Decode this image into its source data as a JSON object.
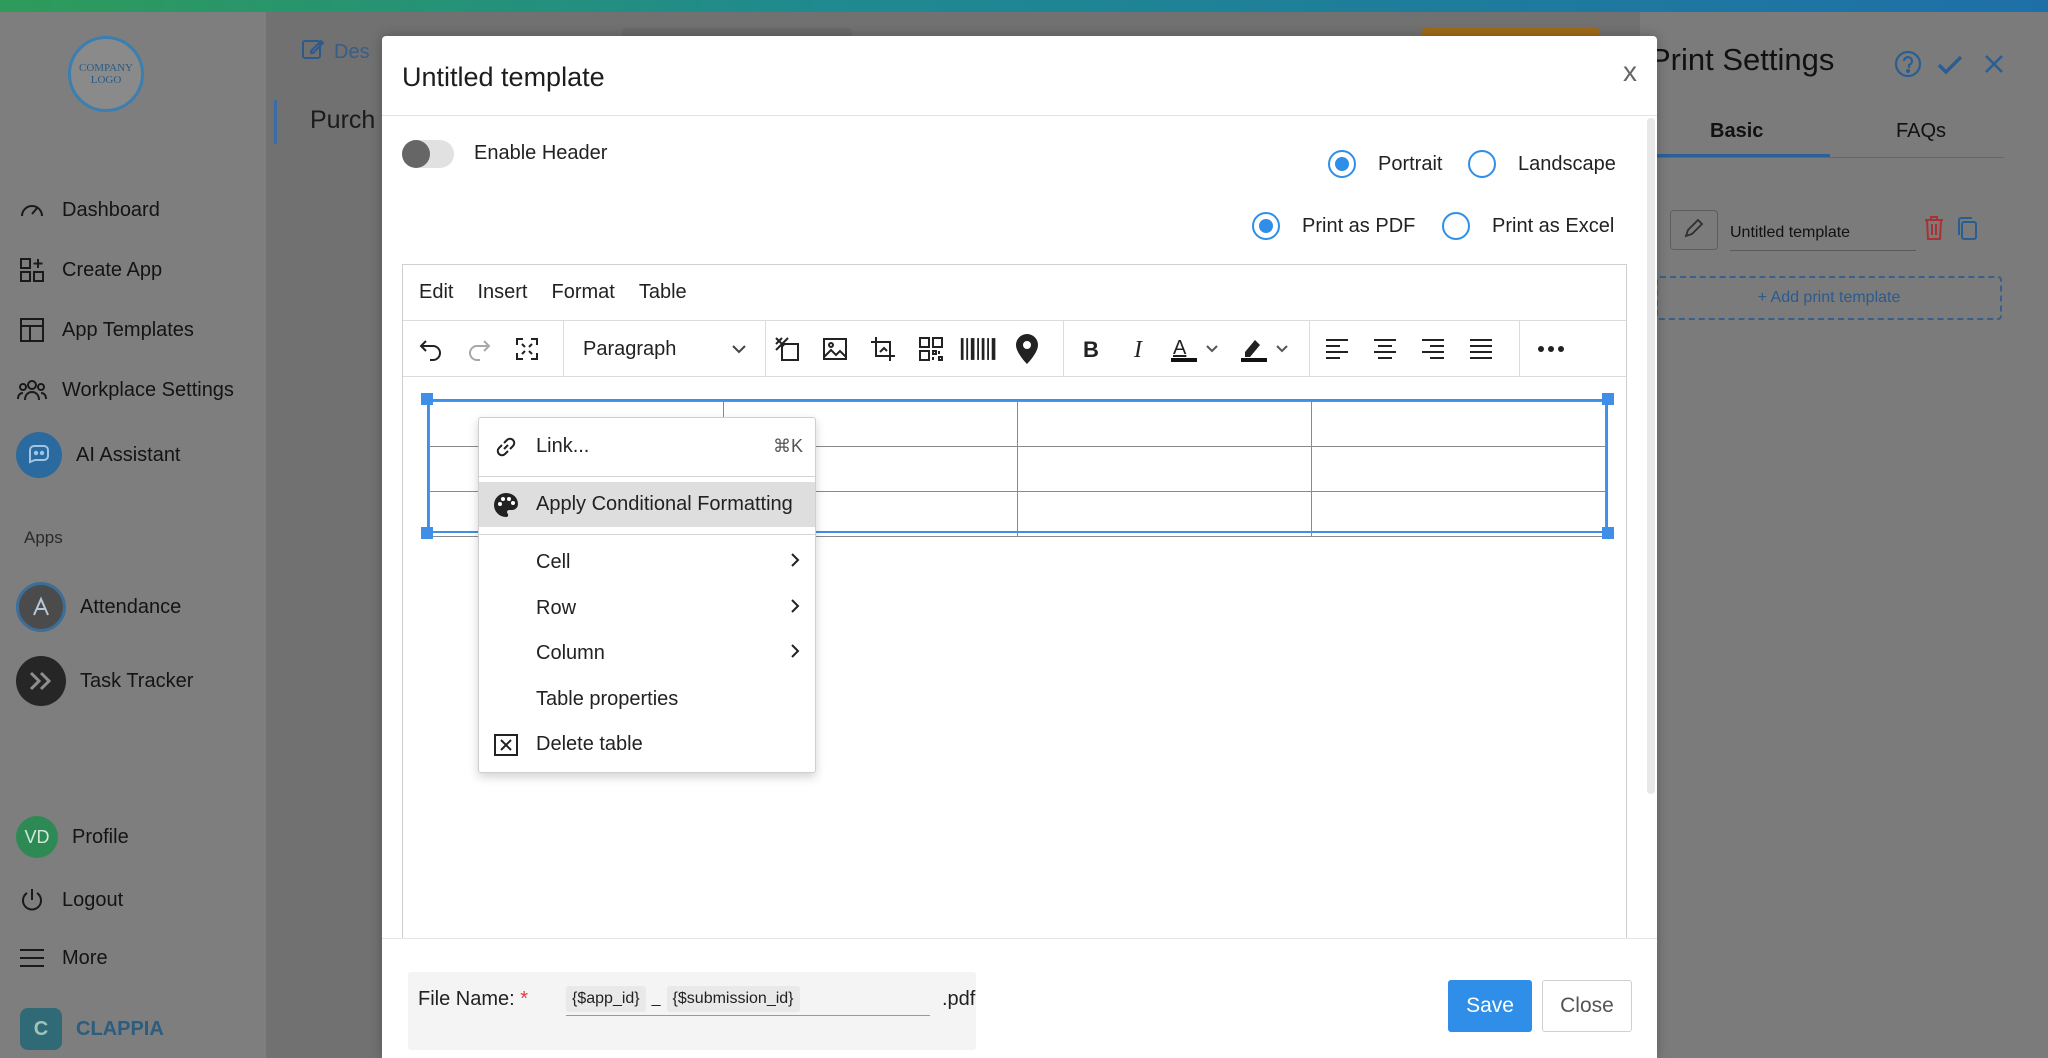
{
  "sidebar": {
    "logo_text": "COMPANY LOGO",
    "items": [
      {
        "label": "Dashboard"
      },
      {
        "label": "Create App"
      },
      {
        "label": "App Templates"
      },
      {
        "label": "Workplace Settings"
      },
      {
        "label": "AI Assistant"
      }
    ],
    "apps_heading": "Apps",
    "apps": [
      {
        "label": "Attendance"
      },
      {
        "label": "Task Tracker"
      }
    ],
    "profile": {
      "initials": "VD",
      "label": "Profile"
    },
    "logout": "Logout",
    "more": "More",
    "brand": "CLAPPIA"
  },
  "background": {
    "breadcrumb": "Des",
    "title": "Purch"
  },
  "print_settings": {
    "title": "Print Settings",
    "tabs": [
      "Basic",
      "FAQs"
    ],
    "template_name": "Untitled template",
    "add_template": "+ Add print template"
  },
  "modal": {
    "title": "Untitled template",
    "close": "x",
    "enable_header_label": "Enable Header",
    "orientation": [
      "Portrait",
      "Landscape"
    ],
    "output": [
      "Print as PDF",
      "Print as Excel"
    ]
  },
  "editor": {
    "menus": [
      "Edit",
      "Insert",
      "Format",
      "Table"
    ],
    "block_format": "Paragraph"
  },
  "context_menu": {
    "link": {
      "label": "Link...",
      "shortcut": "⌘K"
    },
    "conditional": "Apply Conditional Formatting",
    "cell": "Cell",
    "row": "Row",
    "column": "Column",
    "table_properties": "Table properties",
    "delete_table": "Delete table"
  },
  "footer": {
    "file_name_label": "File Name:",
    "required_mark": "*",
    "chip1": "{$app_id}",
    "separator": "_",
    "chip2": "{$submission_id}",
    "extension": ".pdf",
    "save": "Save",
    "close": "Close"
  }
}
